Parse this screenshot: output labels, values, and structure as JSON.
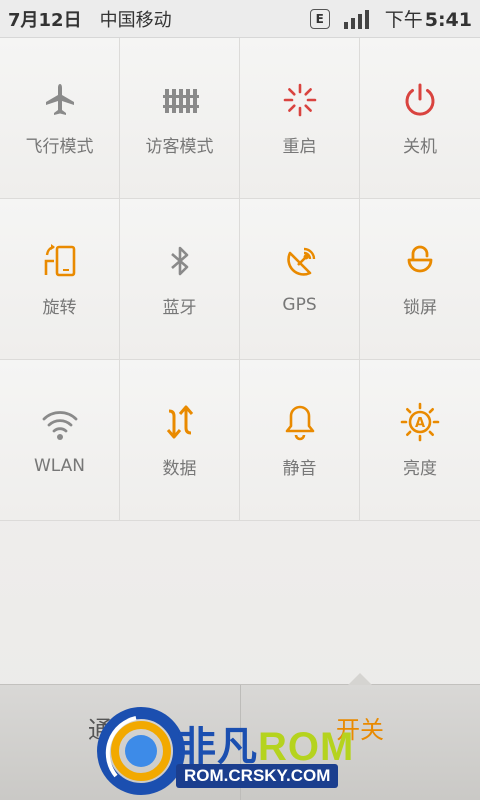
{
  "status_bar": {
    "date": "7月12日",
    "carrier": "中国移动",
    "network": "E",
    "signal_level": 4,
    "time_prefix": "下午",
    "time": "5:41"
  },
  "toggles": [
    {
      "id": "airplane",
      "label": "飞行模式",
      "icon": "airplane-icon",
      "state": "off"
    },
    {
      "id": "guest",
      "label": "访客模式",
      "icon": "guest-fence-icon",
      "state": "off"
    },
    {
      "id": "reboot",
      "label": "重启",
      "icon": "reboot-icon",
      "state": "action"
    },
    {
      "id": "power-off",
      "label": "关机",
      "icon": "power-icon",
      "state": "action"
    },
    {
      "id": "rotate",
      "label": "旋转",
      "icon": "rotate-icon",
      "state": "on"
    },
    {
      "id": "bluetooth",
      "label": "蓝牙",
      "icon": "bluetooth-icon",
      "state": "off"
    },
    {
      "id": "gps",
      "label": "GPS",
      "icon": "gps-icon",
      "state": "on"
    },
    {
      "id": "lockscreen",
      "label": "锁屏",
      "icon": "lock-icon",
      "state": "on"
    },
    {
      "id": "wlan",
      "label": "WLAN",
      "icon": "wifi-icon",
      "state": "off"
    },
    {
      "id": "data",
      "label": "数据",
      "icon": "data-arrows-icon",
      "state": "on"
    },
    {
      "id": "mute",
      "label": "静音",
      "icon": "bell-icon",
      "state": "on"
    },
    {
      "id": "brightness",
      "label": "亮度",
      "icon": "auto-brightness-icon",
      "state": "on"
    }
  ],
  "bottom_tabs": {
    "left_label": "通",
    "right_label": "开关"
  },
  "watermark": {
    "brand_a": "非凡",
    "brand_b": "ROM",
    "url": "ROM.CRSKY.COM"
  },
  "colors": {
    "active": "#e98a00",
    "inactive": "#8a8a8a",
    "danger": "#d9433f"
  }
}
